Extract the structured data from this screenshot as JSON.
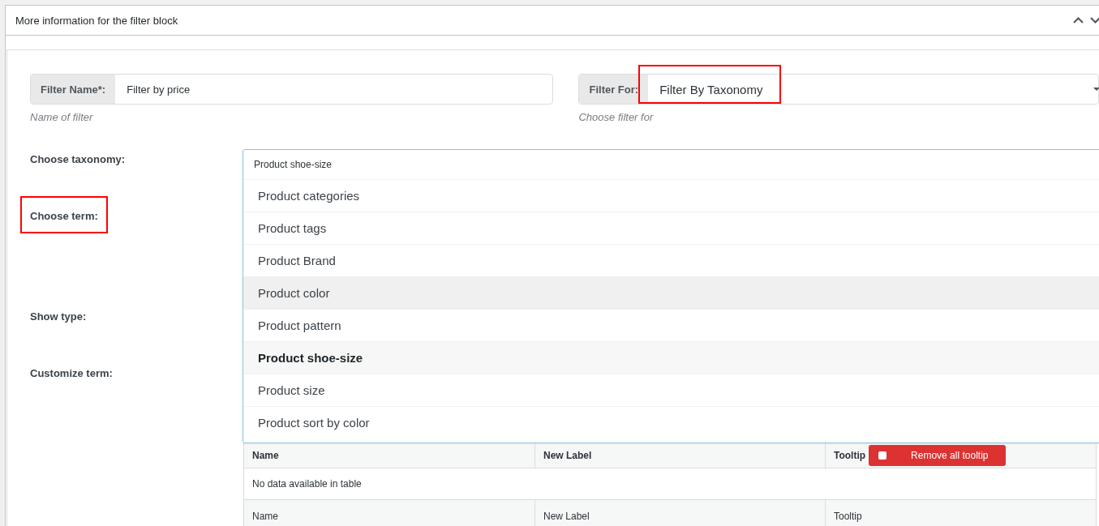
{
  "panel": {
    "title": "More information for the filter block"
  },
  "filter_name": {
    "label": "Filter Name*:",
    "value": "Filter by price",
    "hint": "Name of filter"
  },
  "filter_for": {
    "label": "Filter For:",
    "value": "Filter By Taxonomy",
    "hint": "Choose filter for",
    "highlighted": true
  },
  "fields": [
    {
      "label": "Choose taxonomy:",
      "highlighted": false
    },
    {
      "label": "Choose term:",
      "highlighted": true
    },
    {
      "label": "Show type:",
      "highlighted": false
    },
    {
      "label": "Customize term:",
      "highlighted": false
    }
  ],
  "taxonomy_dropdown": {
    "value": "Product shoe-size",
    "options": [
      {
        "label": "Product categories",
        "hovered": false,
        "selected": false
      },
      {
        "label": "Product tags",
        "hovered": false,
        "selected": false
      },
      {
        "label": "Product Brand",
        "hovered": false,
        "selected": false
      },
      {
        "label": "Product color",
        "hovered": true,
        "selected": false
      },
      {
        "label": "Product pattern",
        "hovered": false,
        "selected": false
      },
      {
        "label": "Product shoe-size",
        "hovered": false,
        "selected": true
      },
      {
        "label": "Product size",
        "hovered": false,
        "selected": false
      },
      {
        "label": "Product sort by color",
        "hovered": false,
        "selected": false
      }
    ]
  },
  "terms_table": {
    "columns": [
      "Name",
      "New Label",
      "Tooltip"
    ],
    "remove_tooltip_button": {
      "label": "Remove all tooltip",
      "checked": false
    },
    "empty_message": "No data available in table",
    "footer": [
      "Name",
      "New Label",
      "Tooltip"
    ]
  }
}
